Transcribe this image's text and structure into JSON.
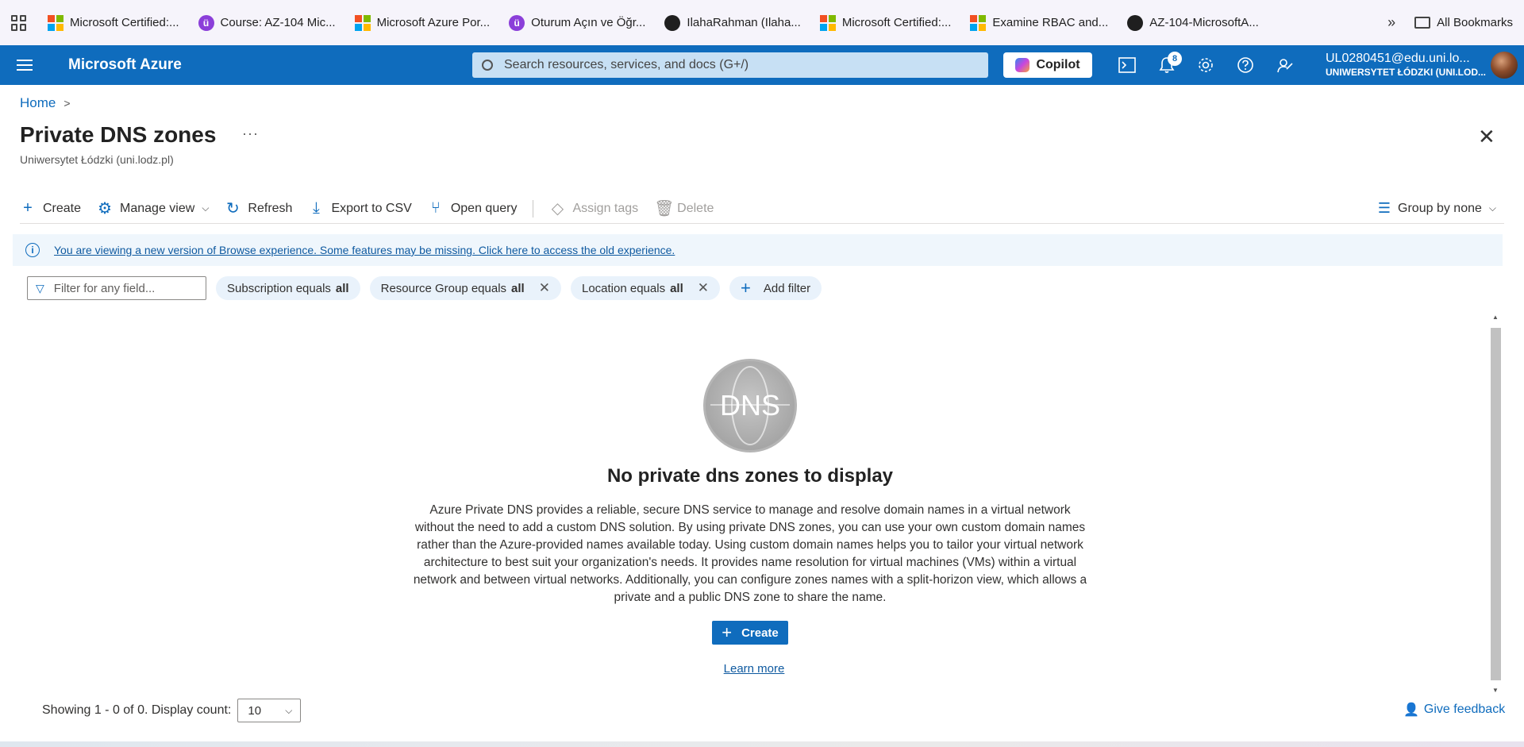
{
  "bookmarks": {
    "items": [
      {
        "label": "Microsoft Certified:...",
        "icon": "microsoft-logo"
      },
      {
        "label": "Course: AZ-104 Mic...",
        "icon": "udemy-logo"
      },
      {
        "label": "Microsoft Azure Por...",
        "icon": "microsoft-logo"
      },
      {
        "label": "Oturum Açın ve Öğr...",
        "icon": "udemy-logo"
      },
      {
        "label": "IlahaRahman (Ilaha...",
        "icon": "github-logo"
      },
      {
        "label": "Microsoft Certified:...",
        "icon": "microsoft-logo"
      },
      {
        "label": "Examine RBAC and...",
        "icon": "microsoft-logo"
      },
      {
        "label": "AZ-104-MicrosoftA...",
        "icon": "github-logo"
      }
    ],
    "overflow": "»",
    "all_bookmarks": "All Bookmarks"
  },
  "header": {
    "brand": "Microsoft Azure",
    "search_placeholder": "Search resources, services, and docs (G+/)",
    "copilot": "Copilot",
    "notification_count": "8",
    "account_email": "UL0280451@edu.uni.lo...",
    "account_org": "UNIWERSYTET ŁÓDZKI (UNI.LOD..."
  },
  "breadcrumb": {
    "home": "Home"
  },
  "page": {
    "title": "Private DNS zones",
    "more": "···",
    "subtitle": "Uniwersytet Łódzki (uni.lodz.pl)"
  },
  "toolbar": {
    "create": "Create",
    "manage_view": "Manage view",
    "refresh": "Refresh",
    "export_csv": "Export to CSV",
    "open_query": "Open query",
    "assign_tags": "Assign tags",
    "delete": "Delete",
    "group_by": "Group by none"
  },
  "banner": {
    "text": "You are viewing a new version of Browse experience. Some features may be missing. Click here to access the old experience."
  },
  "filters": {
    "placeholder": "Filter for any field...",
    "subscription_label": "Subscription equals",
    "subscription_value": "all",
    "resource_group_label": "Resource Group equals",
    "resource_group_value": "all",
    "location_label": "Location equals",
    "location_value": "all",
    "add_filter": "Add filter"
  },
  "empty_state": {
    "icon_text": "DNS",
    "heading": "No private dns zones to display",
    "description": "Azure Private DNS provides a reliable, secure DNS service to manage and resolve domain names in a virtual network without the need to add a custom DNS solution. By using private DNS zones, you can use your own custom domain names rather than the Azure-provided names available today. Using custom domain names helps you to tailor your virtual network architecture to best suit your organization's needs. It provides name resolution for virtual machines (VMs) within a virtual network and between virtual networks. Additionally, you can configure zones names with a split-horizon view, which allows a private and a public DNS zone to share the name.",
    "create": "Create",
    "learn_more": "Learn more"
  },
  "footer": {
    "showing": "Showing 1 - 0 of 0. Display count:",
    "display_count": "10",
    "feedback": "Give feedback"
  }
}
